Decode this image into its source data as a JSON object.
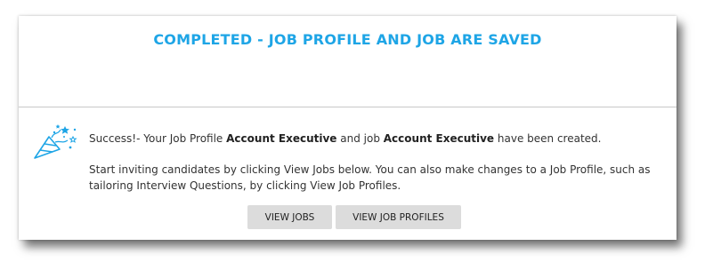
{
  "header": {
    "title": "COMPLETED - JOB PROFILE AND JOB ARE SAVED"
  },
  "message": {
    "prefix": "Success!- Your Job Profile ",
    "profile_name": "Account Executive",
    "middle": " and job ",
    "job_name": "Account Executive",
    "suffix": " have been created.",
    "instructions": "Start inviting candidates by clicking View Jobs below. You can also make changes to a Job Profile, such as tailoring Interview Questions, by clicking View Job Profiles."
  },
  "buttons": {
    "view_jobs": "VIEW JOBS",
    "view_job_profiles": "VIEW JOB PROFILES"
  },
  "icons": {
    "celebration": "party-popper-icon"
  },
  "colors": {
    "accent": "#1ea5e6",
    "button_bg": "#dcdcdc"
  }
}
